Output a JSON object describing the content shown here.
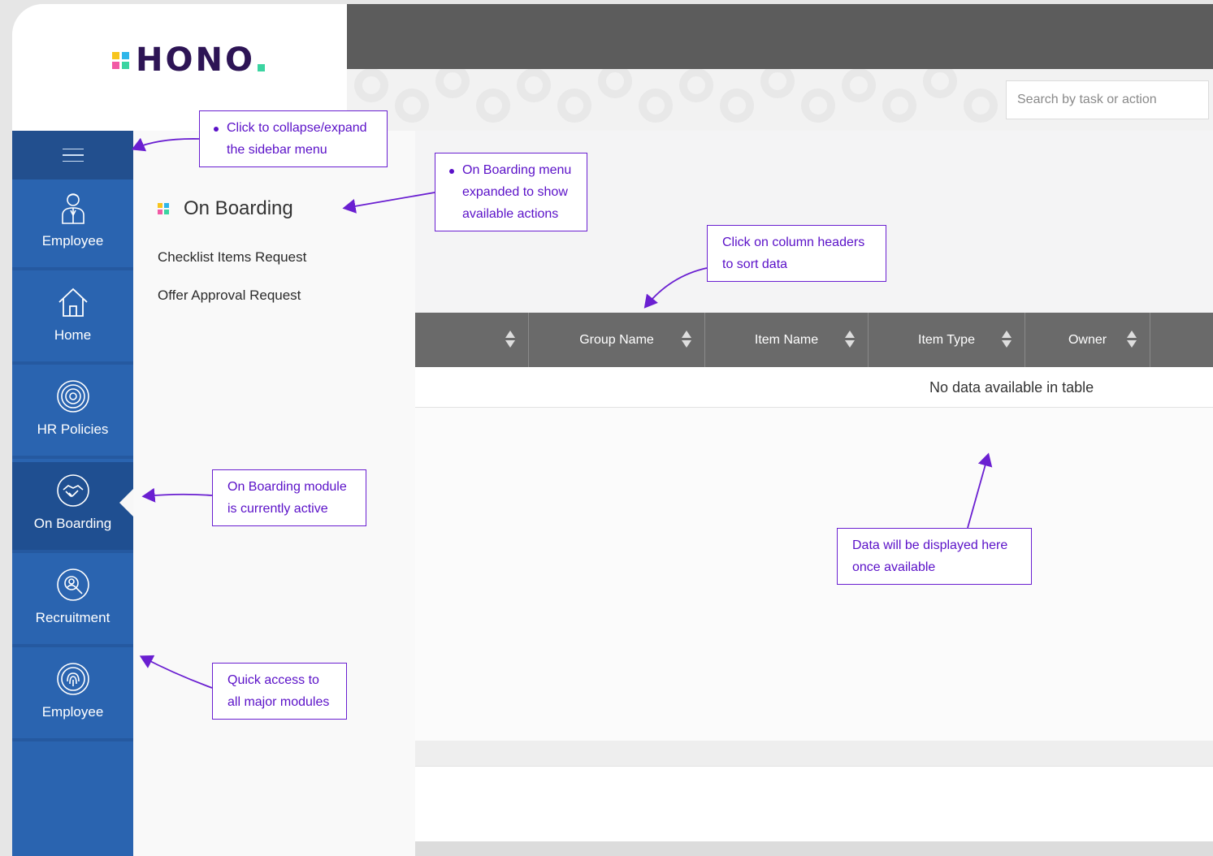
{
  "brand": {
    "name": "HONO"
  },
  "search": {
    "placeholder": "Search by task or action"
  },
  "sidebar": {
    "items": [
      {
        "label": "Employee",
        "icon": "user-icon"
      },
      {
        "label": "Home",
        "icon": "home-icon"
      },
      {
        "label": "HR Policies",
        "icon": "target-icon"
      },
      {
        "label": "On Boarding",
        "icon": "handshake-icon",
        "active": true
      },
      {
        "label": "Recruitment",
        "icon": "search-person-icon"
      },
      {
        "label": "Employee",
        "icon": "fingerprint-icon"
      }
    ]
  },
  "submenu": {
    "title": "On Boarding",
    "links": [
      "Checklist Items Request",
      "Offer Approval Request"
    ]
  },
  "table": {
    "columns": [
      "",
      "Group Name",
      "Item Name",
      "Item Type",
      "Owner"
    ],
    "empty_message": "No data available in table"
  },
  "annotations": {
    "collapse": [
      "Click to collapse/expand",
      "the sidebar menu"
    ],
    "submenu": [
      "On Boarding menu",
      "expanded to show",
      "available actions"
    ],
    "sort": [
      "Click on column headers",
      "to sort data"
    ],
    "active": [
      "On Boarding module",
      "is currently active"
    ],
    "data": [
      "Data will be displayed here",
      "once available"
    ],
    "quick": [
      "Quick access to",
      "all major modules"
    ]
  },
  "colors": {
    "sidebar": "#2a64b0",
    "sidebar_active": "#1f4f91",
    "topbar": "#5c5c5c",
    "table_header": "#6a6a6a",
    "annotation": "#6a1fd1",
    "logo_text": "#2d1455"
  }
}
